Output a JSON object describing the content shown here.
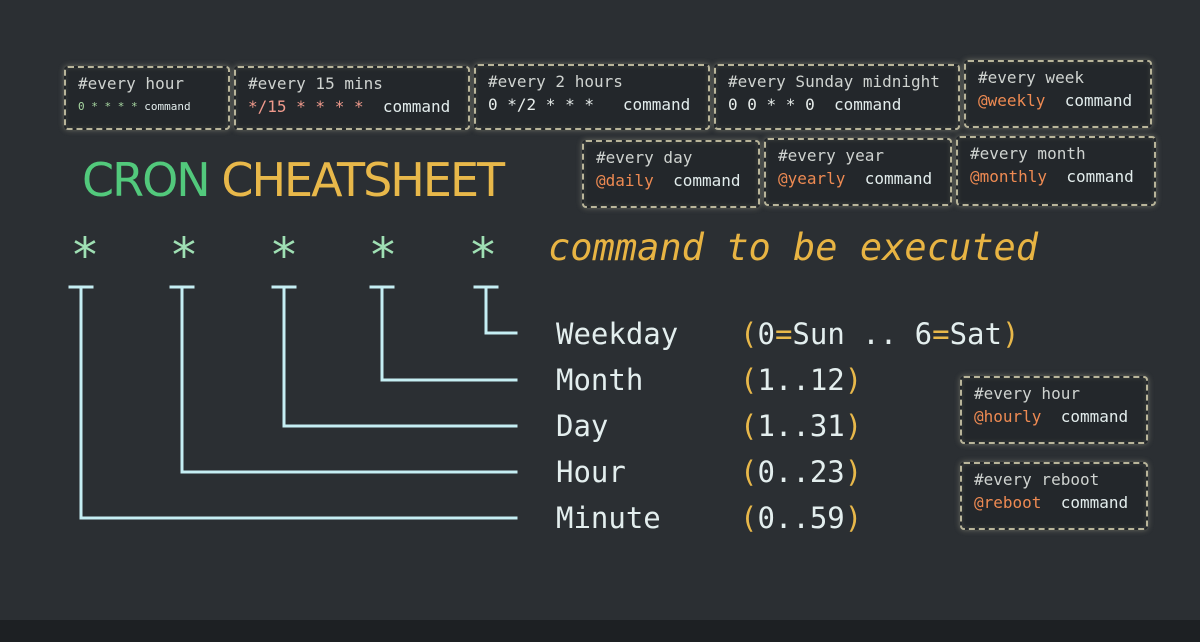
{
  "title": {
    "part1": "CRON",
    "part2": "CHEATSHEET"
  },
  "tagline": "command to be executed",
  "stars": [
    "*",
    "*",
    "*",
    "*",
    "*"
  ],
  "fields": [
    {
      "label": "Weekday",
      "range_open": "(",
      "range_a": "0",
      "eq1": "=",
      "range_b": "Sun .. 6",
      "eq2": "=",
      "range_c": "Sat",
      "range_close": ")"
    },
    {
      "label": "Month",
      "range_open": "(",
      "range_text": "1..12",
      "range_close": ")"
    },
    {
      "label": "Day",
      "range_open": "(",
      "range_text": "1..31",
      "range_close": ")"
    },
    {
      "label": "Hour",
      "range_open": "(",
      "range_text": "0..23",
      "range_close": ")"
    },
    {
      "label": "Minute",
      "range_open": "(",
      "range_text": "0..59",
      "range_close": ")"
    }
  ],
  "cards": {
    "every_hour_top": {
      "title": "#every hour",
      "expr": "0 * * * *",
      "cmd": "command"
    },
    "every_15": {
      "title": "#every 15 mins",
      "expr": "*/15 * * * *",
      "cmd": "command"
    },
    "every_2h": {
      "title": "#every 2 hours",
      "expr": "0 */2 * * *",
      "cmd": "command"
    },
    "every_sunday": {
      "title": "#every Sunday midnight",
      "expr": "0 0 * * 0",
      "cmd": "command"
    },
    "every_week": {
      "title": "#every week",
      "expr": "@weekly",
      "cmd": "command"
    },
    "every_day": {
      "title": "#every day",
      "expr": "@daily",
      "cmd": "command"
    },
    "every_year": {
      "title": "#every year",
      "expr": "@yearly",
      "cmd": "command"
    },
    "every_month": {
      "title": "#every month",
      "expr": "@monthly",
      "cmd": "command"
    },
    "every_hour_side": {
      "title": "#every hour",
      "expr": "@hourly",
      "cmd": "command"
    },
    "every_reboot": {
      "title": "#every reboot",
      "expr": "@reboot",
      "cmd": "command"
    }
  },
  "colors": {
    "background": "#2b2f33",
    "green": "#52c97c",
    "yellow": "#e8b84a",
    "orange": "#ee8a52",
    "tree_line": "#c5eef3",
    "star": "#9fe0b4"
  }
}
